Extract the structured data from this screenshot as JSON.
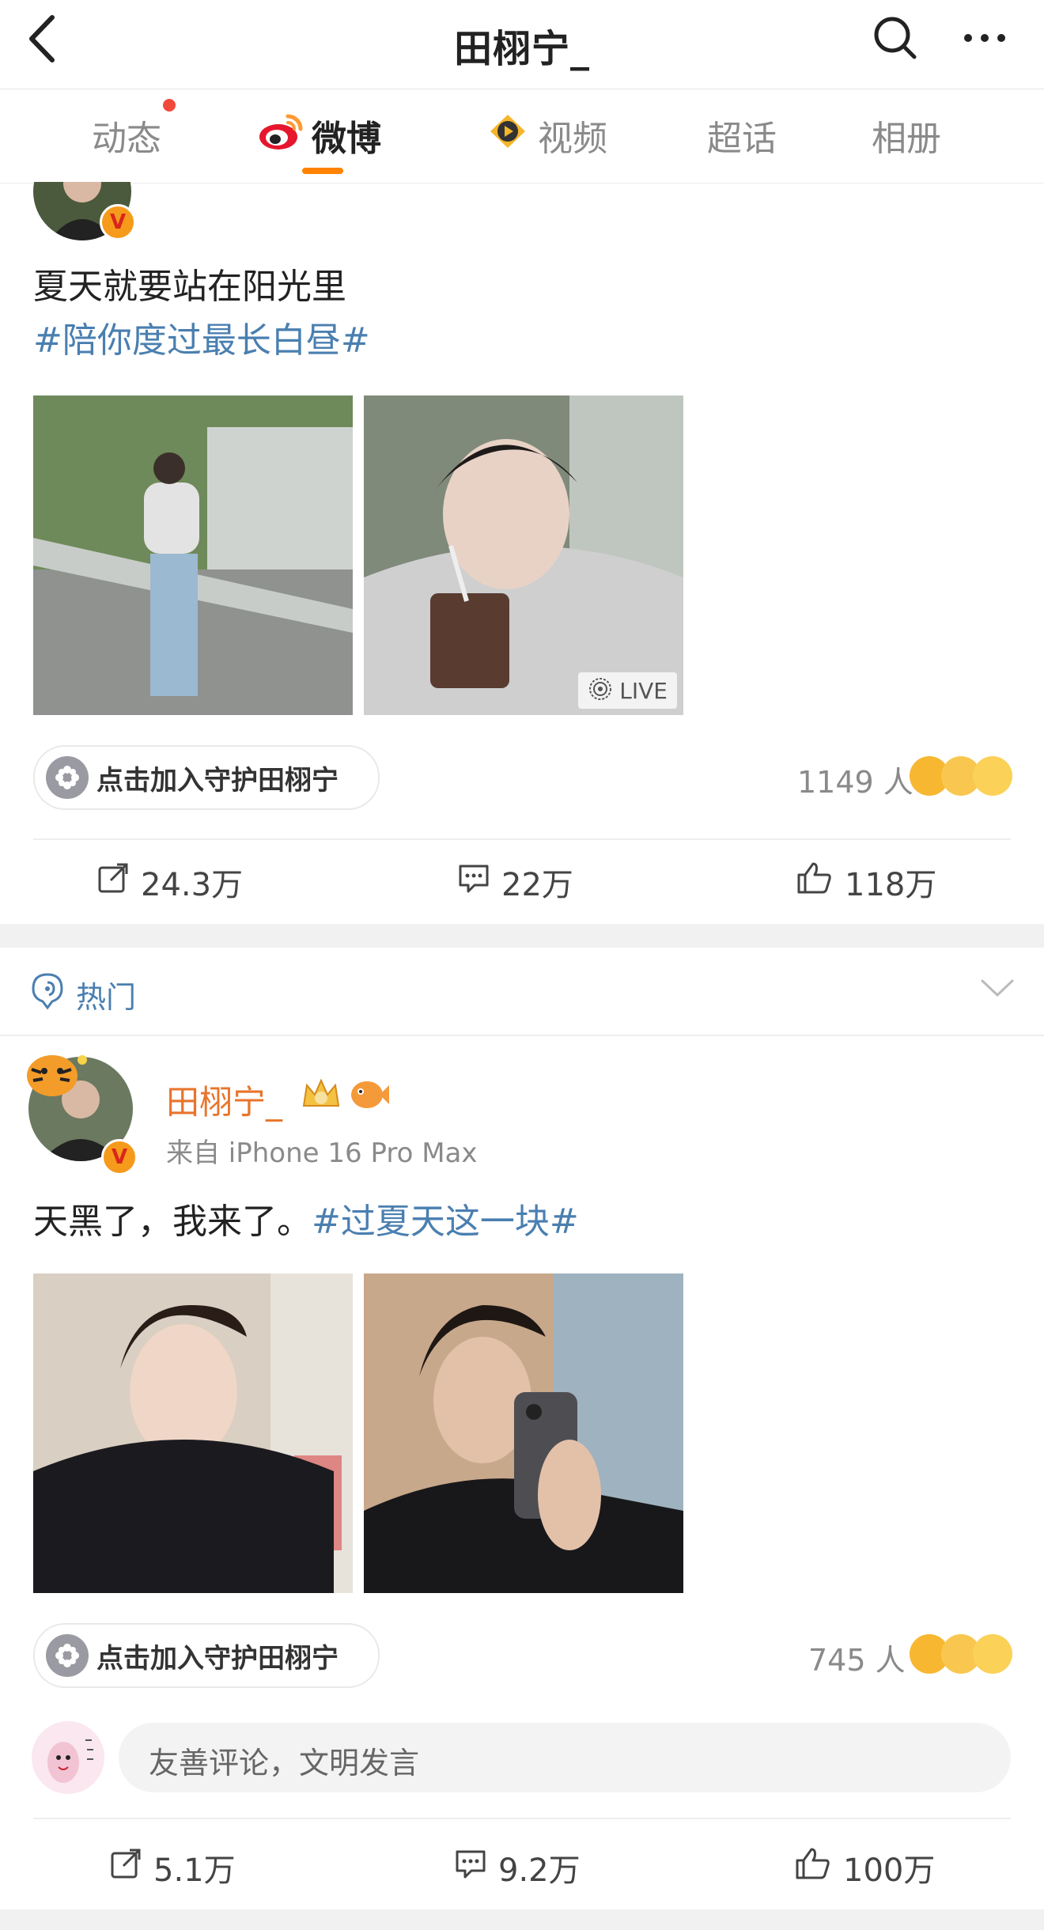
{
  "header": {
    "title": "田栩宁_"
  },
  "tabs": [
    {
      "label": "动态",
      "has_dot": true
    },
    {
      "label": "微博",
      "active": true
    },
    {
      "label": "视频"
    },
    {
      "label": "超话"
    },
    {
      "label": "相册"
    }
  ],
  "post1": {
    "text": "夏天就要站在阳光里",
    "hashtag": "#陪你度过最长白昼#",
    "live_label": "LIVE",
    "guard_label": "点击加入守护田栩宁",
    "guard_count": "1149 人",
    "actions": {
      "repost": "24.3万",
      "comment": "22万",
      "like": "118万"
    }
  },
  "hot_section": {
    "label": "热门"
  },
  "post2": {
    "author": "田栩宁_",
    "source": "来自 iPhone 16 Pro Max",
    "text": "天黑了，我来了。",
    "hashtag": "#过夏天这一块#",
    "guard_label": "点击加入守护田栩宁",
    "guard_count": "745 人",
    "comment_placeholder": "友善评论，文明发言",
    "actions": {
      "repost": "5.1万",
      "comment": "9.2万",
      "like": "100万"
    }
  },
  "colors": {
    "accent": "#ff8200",
    "hashtag": "#4a7fb0",
    "author": "#e8742c"
  }
}
